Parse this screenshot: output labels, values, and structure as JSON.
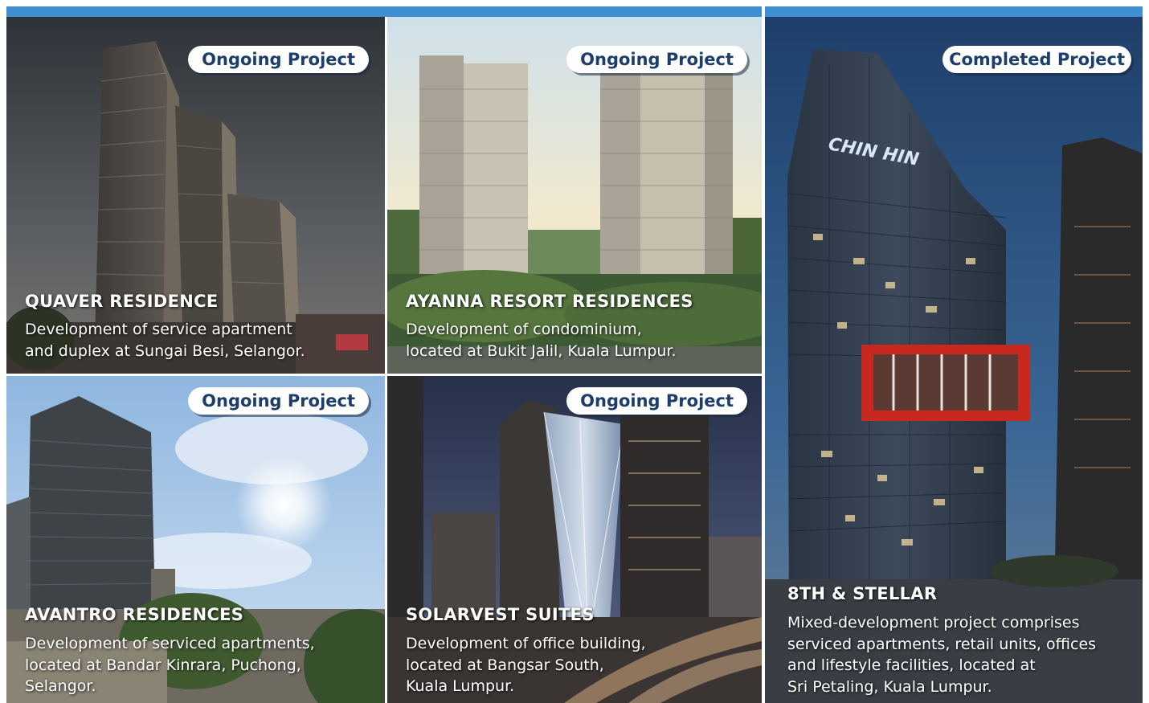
{
  "badges": {
    "ongoing": "Ongoing Project",
    "completed": "Completed Project"
  },
  "projects": [
    {
      "title": "QUAVER RESIDENCE",
      "status": "Ongoing Project",
      "description_lines": [
        "Development of service apartment",
        "and duplex at Sungai Besi, Selangor."
      ]
    },
    {
      "title": "AYANNA RESORT RESIDENCES",
      "status": "Ongoing Project",
      "description_lines": [
        "Development of condominium,",
        "located at Bukit Jalil, Kuala Lumpur."
      ]
    },
    {
      "title": "AVANTRO RESIDENCES",
      "status": "Ongoing Project",
      "description_lines": [
        "Development of serviced apartments,",
        "located at Bandar Kinrara, Puchong,",
        "Selangor."
      ]
    },
    {
      "title": "SOLARVEST SUITES",
      "status": "Ongoing Project",
      "description_lines": [
        "Development of office building,",
        "located at Bangsar South,",
        "Kuala Lumpur."
      ]
    },
    {
      "title": "8TH & STELLAR",
      "status": "Completed Project",
      "description_lines": [
        "Mixed-development project comprises",
        "serviced apartments, retail units, offices",
        "and lifestyle facilities, located at",
        "Sri Petaling, Kuala Lumpur."
      ],
      "building_sign": "CHIN HIN"
    }
  ],
  "colors": {
    "header_bar": "#3f8fd3",
    "badge_text": "#1d3d6b",
    "sign_accent": "#c8281e"
  }
}
